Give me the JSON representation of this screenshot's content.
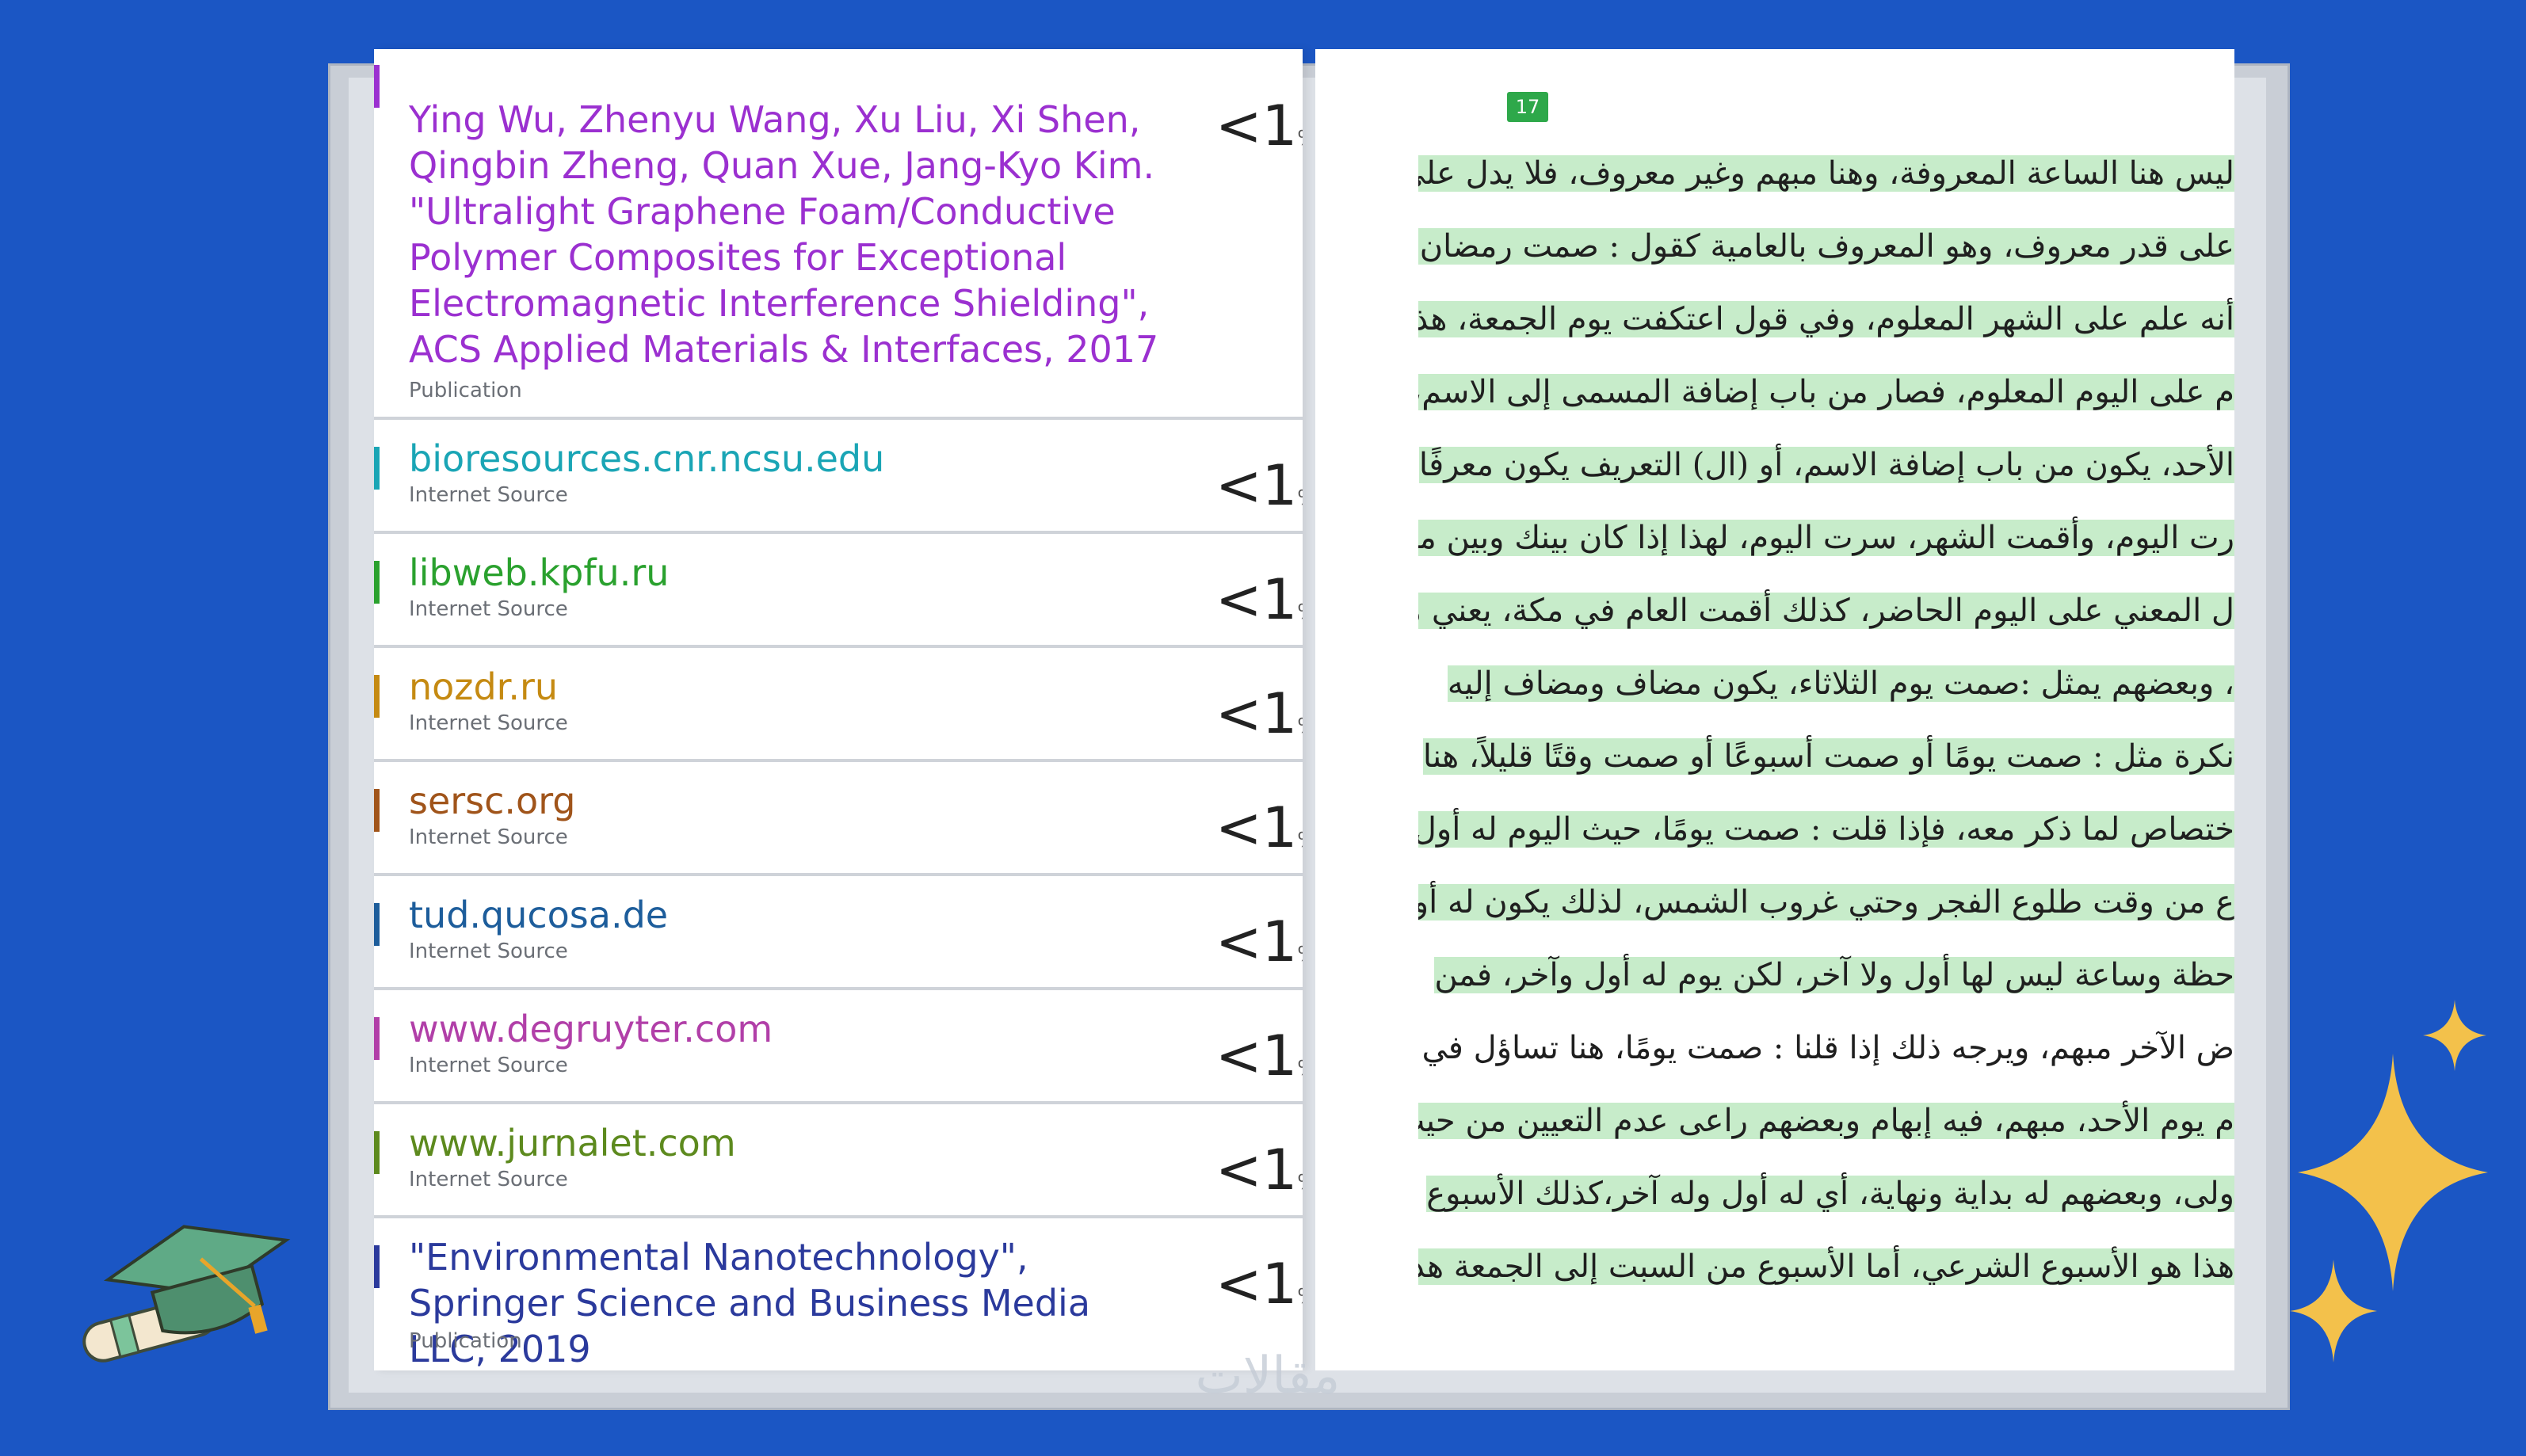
{
  "sources": [
    {
      "title": "Ying Wu, Zhenyu Wang, Xu Liu, Xi Shen, Qingbin Zheng, Quan Xue, Jang-Kyo Kim. \"Ultralight Graphene Foam/Conductive Polymer Composites for Exceptional Electromagnetic Interference Shielding\", ACS Applied Materials & Interfaces, 2017",
      "type": "Publication",
      "pct": "<1",
      "color": "#9b30d0"
    },
    {
      "title": "bioresources.cnr.ncsu.edu",
      "type": "Internet Source",
      "pct": "<1",
      "color": "#1aa5b5"
    },
    {
      "title": "libweb.kpfu.ru",
      "type": "Internet Source",
      "pct": "<1",
      "color": "#2aa12e"
    },
    {
      "title": "nozdr.ru",
      "type": "Internet Source",
      "pct": "<1",
      "color": "#c58a12"
    },
    {
      "title": "sersc.org",
      "type": "Internet Source",
      "pct": "<1",
      "color": "#a0541a"
    },
    {
      "title": "tud.qucosa.de",
      "type": "Internet Source",
      "pct": "<1",
      "color": "#1d5d9b"
    },
    {
      "title": "www.degruyter.com",
      "type": "Internet Source",
      "pct": "<1",
      "color": "#b13fa8"
    },
    {
      "title": "www.jurnalet.com",
      "type": "Internet Source",
      "pct": "<1",
      "color": "#5d8a1e"
    },
    {
      "title": "\"Environmental Nanotechnology\", Springer Science and Business Media LLC, 2019",
      "type": "Publication",
      "pct": "<1",
      "color": "#2b3a9c"
    }
  ],
  "page_tag": "17",
  "arabic_lines": [
    "ليس هنا الساعة المعروفة، وهنا مبهم وغير معروف، فلا يدل على",
    "على قدر معروف، وهو المعروف بالعامية كقول : صمت رمضان،",
    "أنه علم على الشهر المعلوم، وفي قول اعتكفت يوم الجمعة، هذا علم",
    "م على اليوم المعلوم، فصار من باب إضافة المسمى إلى الاسم، يوم",
    "الأحد، يكون من باب إضافة الاسم، أو (ال) التعريف يكون معرفًا",
    "رت اليوم، وأقمت الشهر، سرت اليوم، لهذا إذا كان بينك وبين من",
    "ل المعني على اليوم الحاضر، كذلك أقمت العام في مكة، يعني مثلاً",
    "، وبعضهم يمثل :صمت يوم الثلاثاء، يكون مضاف ومضاف إليه",
    "نكرة مثل : صمت يومًا أو صمت أسبوعًا أو صمت وقتًا قليلاً، هنا",
    "ختصاص لما ذكر معه، فإذا قلت : صمت يومًا، حيث اليوم له أول",
    "ع من وقت طلوع الفجر وحتي غروب الشمس، لذلك يكون له أول",
    "حظة وساعة ليس لها أول ولا آخر، لكن يوم له أول وآخر، فمن",
    "ض الآخر مبهم، ويرجه ذلك إذا قلنا : صمت يومًا، هنا تساؤل في",
    "م يوم الأحد، مبهم، فيه إبهام وبعضهم راعى عدم التعيين من حيث",
    "ولى، وبعضهم له بداية ونهاية، أي له أول وله آخر،كذلك الأسبوع",
    "هذا هو الأسبوع الشرعي، أما الأسبوع من السبت إلى الجمعة هذا"
  ],
  "watermark": "مقالات"
}
